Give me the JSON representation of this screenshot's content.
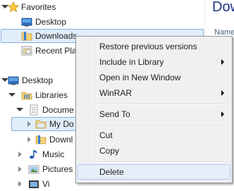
{
  "nav": {
    "favorites": "Favorites",
    "desktop_fav": "Desktop",
    "downloads": "Downloads",
    "recent_places": "Recent Pla",
    "desktop": "Desktop",
    "libraries": "Libraries",
    "documents": "Docume",
    "my_documents": "My Do",
    "downloads_lib": "Downl",
    "music": "Music",
    "pictures": "Pictures",
    "videos": "Vi"
  },
  "main": {
    "title": "Dow",
    "column": "Name"
  },
  "context_menu": {
    "items": [
      {
        "label": "Restore previous versions"
      },
      {
        "label": "Include in Library",
        "submenu": true
      },
      {
        "label": "Open in New Window"
      },
      {
        "label": "WinRAR",
        "submenu": true
      },
      {
        "label": "Send To",
        "submenu": true
      },
      {
        "label": "Cut"
      },
      {
        "label": "Copy"
      },
      {
        "label": "Delete",
        "highlighted": true
      }
    ]
  },
  "colors": {
    "selection_bg": "#e0edfb",
    "selection_border": "#84acdd",
    "menu_bg": "#f0f0f0",
    "title_blue": "#1e3287"
  }
}
